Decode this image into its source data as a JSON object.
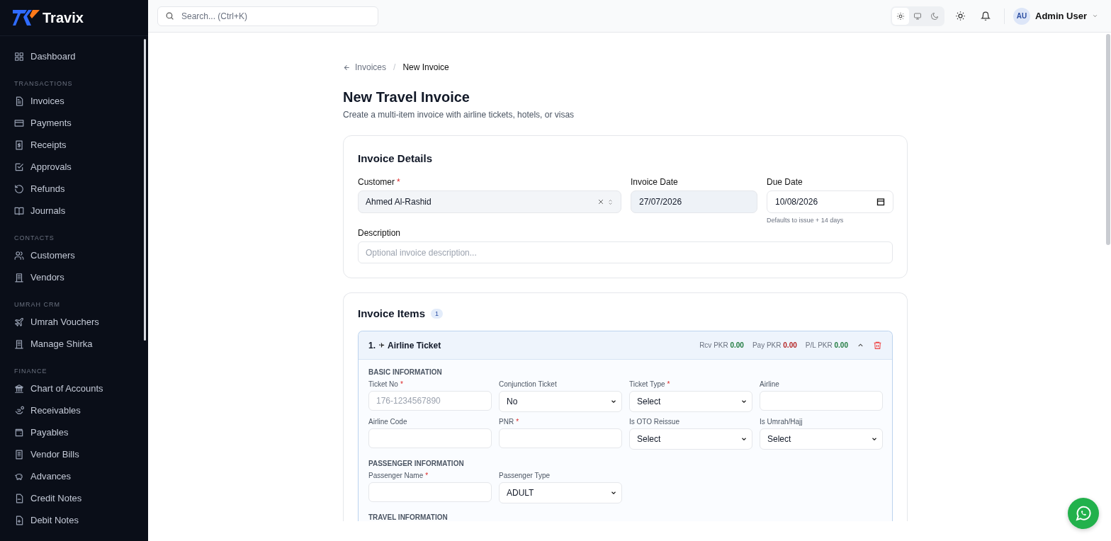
{
  "brand": {
    "name": "Travix"
  },
  "sidebar": {
    "sections": [
      {
        "items": [
          {
            "label": "Dashboard"
          }
        ]
      },
      {
        "title": "TRANSACTIONS",
        "items": [
          {
            "label": "Invoices"
          },
          {
            "label": "Payments"
          },
          {
            "label": "Receipts"
          },
          {
            "label": "Approvals"
          },
          {
            "label": "Refunds"
          },
          {
            "label": "Journals"
          }
        ]
      },
      {
        "title": "CONTACTS",
        "items": [
          {
            "label": "Customers"
          },
          {
            "label": "Vendors"
          }
        ]
      },
      {
        "title": "UMRAH CRM",
        "items": [
          {
            "label": "Umrah Vouchers"
          },
          {
            "label": "Manage Shirka"
          }
        ]
      },
      {
        "title": "FINANCE",
        "items": [
          {
            "label": "Chart of Accounts"
          },
          {
            "label": "Receivables"
          },
          {
            "label": "Payables"
          },
          {
            "label": "Vendor Bills"
          },
          {
            "label": "Advances"
          },
          {
            "label": "Credit Notes"
          },
          {
            "label": "Debit Notes"
          }
        ]
      }
    ]
  },
  "header": {
    "search": {
      "placeholder": "Search... (Ctrl+K)"
    },
    "theme_options": [
      {
        "selected": true
      },
      {
        "selected": false
      },
      {
        "selected": false
      }
    ],
    "user": {
      "initials": "AU",
      "name": "Admin User"
    }
  },
  "breadcrumb": {
    "back": "Invoices",
    "separator": "/",
    "current": "New Invoice"
  },
  "page": {
    "title": "New Travel Invoice",
    "subtitle": "Create a multi-item invoice with airline tickets, hotels, or visas"
  },
  "invoice_details": {
    "title": "Invoice Details",
    "customer": {
      "label": "Customer",
      "required_mark": "*",
      "value": "Ahmed Al-Rashid"
    },
    "invoice_date": {
      "label": "Invoice Date",
      "value": "27/07/2026"
    },
    "due_date": {
      "label": "Due Date",
      "value": "10/08/2026",
      "hint": "Defaults to issue + 14 days"
    },
    "description": {
      "label": "Description",
      "placeholder": "Optional invoice description..."
    }
  },
  "invoice_items": {
    "title": "Invoice Items",
    "count": "1",
    "items": [
      {
        "number": "1.",
        "title": "Airline Ticket",
        "totals": [
          {
            "label": "Rcv PKR",
            "value": "0.00",
            "color": "#1f7a3e"
          },
          {
            "label": "Pay PKR",
            "value": "0.00",
            "color": "#b42323"
          },
          {
            "label": "P/L PKR",
            "value": "0.00",
            "color": "#1f7a3e"
          }
        ],
        "sections": [
          {
            "title": "BASIC INFORMATION",
            "fields": [
              {
                "kind": "input",
                "label": "Ticket No",
                "required_mark": "*",
                "placeholder": "176-1234567890"
              },
              {
                "kind": "select",
                "label": "Conjunction Ticket",
                "value": "No"
              },
              {
                "kind": "select",
                "label": "Ticket Type",
                "required_mark": "*",
                "value": "Select"
              },
              {
                "kind": "input",
                "label": "Airline"
              },
              {
                "kind": "input",
                "label": "Airline Code"
              },
              {
                "kind": "input",
                "label": "PNR",
                "required_mark": "*"
              },
              {
                "kind": "select",
                "label": "Is OTO Reissue",
                "value": "Select"
              },
              {
                "kind": "select",
                "label": "Is Umrah/Hajj",
                "value": "Select"
              }
            ]
          },
          {
            "title": "PASSENGER INFORMATION",
            "fields": [
              {
                "kind": "input",
                "label": "Passenger Name",
                "required_mark": "*"
              },
              {
                "kind": "select",
                "label": "Passenger Type",
                "value": "ADULT"
              }
            ]
          },
          {
            "title": "TRAVEL INFORMATION"
          }
        ]
      }
    ]
  }
}
